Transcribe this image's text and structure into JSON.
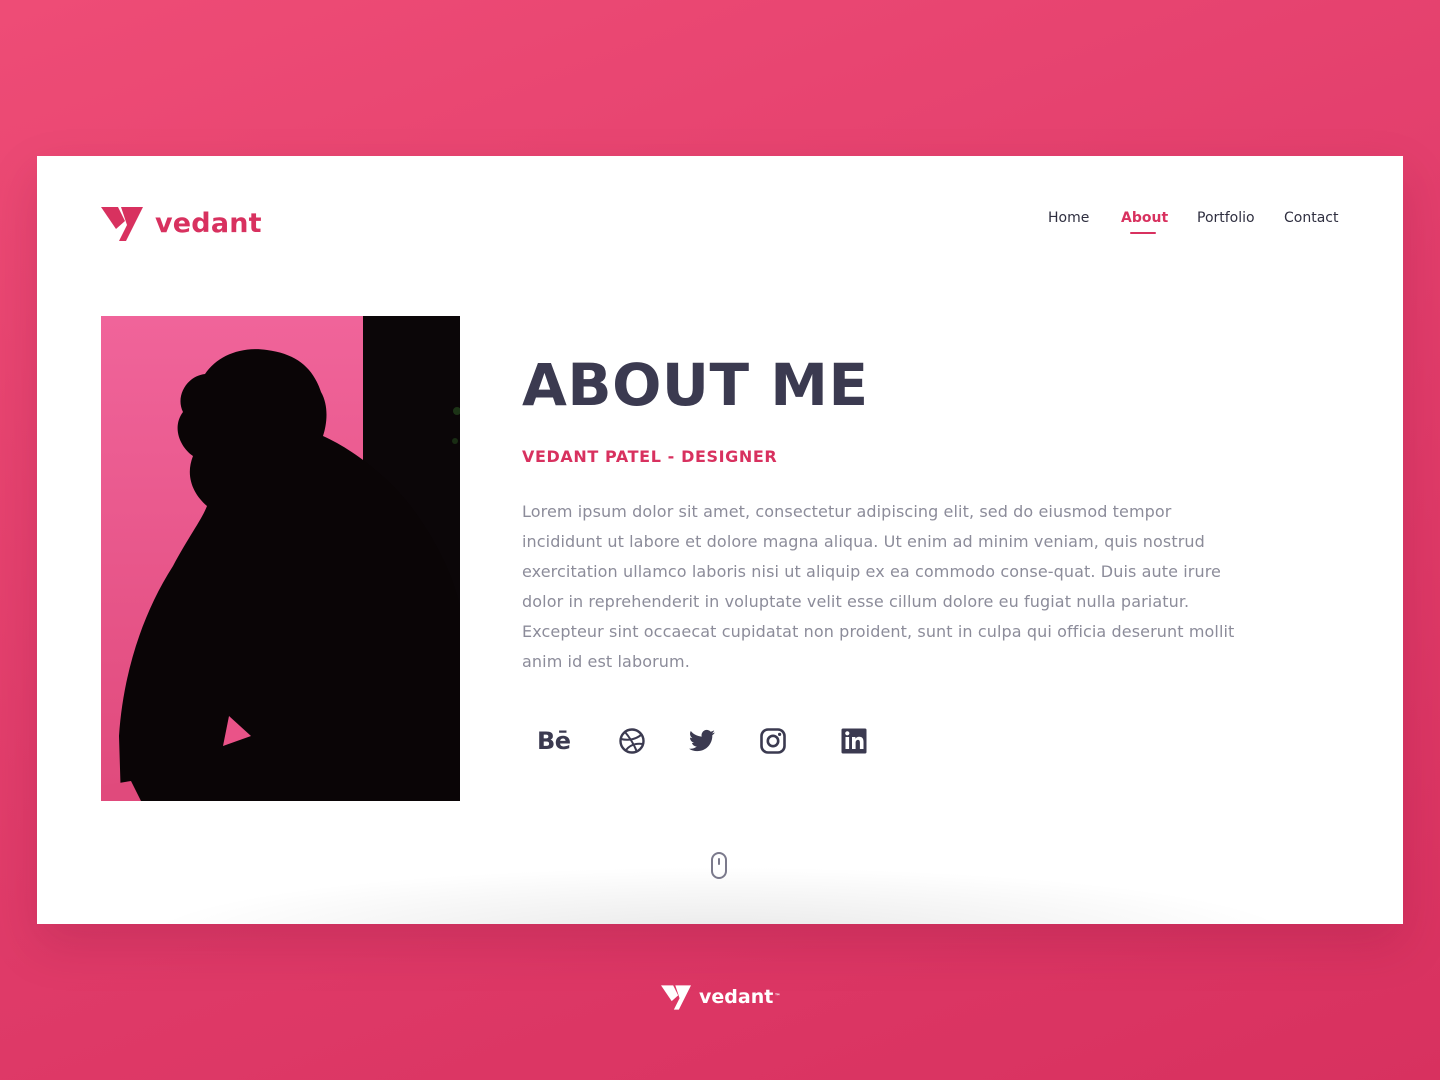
{
  "brand": {
    "name": "vedant",
    "color": "#d8315f",
    "icon": "v-logo-icon"
  },
  "nav": {
    "items": [
      {
        "label": "Home",
        "active": false
      },
      {
        "label": "About",
        "active": true
      },
      {
        "label": "Portfolio",
        "active": false
      },
      {
        "label": "Contact",
        "active": false
      }
    ]
  },
  "about": {
    "heading": "ABOUT ME",
    "subtitle": "VEDANT PATEL - DESIGNER",
    "bio": "Lorem ipsum dolor sit amet, consectetur adipiscing elit, sed do eiusmod tempor incididunt ut labore et dolore magna aliqua. Ut enim ad minim veniam, quis nostrud exercitation ullamco laboris nisi ut aliquip ex ea commodo conse-quat. Duis aute irure dolor in reprehenderit in voluptate velit esse cillum dolore eu fugiat nulla pariatur. Excepteur sint occaecat cupidatat non proident, sunt in culpa qui officia deserunt mollit anim id est laborum."
  },
  "social": [
    {
      "name": "Behance",
      "icon": "behance-icon",
      "glyph": "Bē"
    },
    {
      "name": "Dribbble",
      "icon": "dribbble-icon"
    },
    {
      "name": "Twitter",
      "icon": "twitter-icon"
    },
    {
      "name": "Instagram",
      "icon": "instagram-icon"
    },
    {
      "name": "LinkedIn",
      "icon": "linkedin-icon"
    }
  ],
  "scroll_indicator": {
    "icon": "mouse-scroll-icon"
  },
  "footer": {
    "brand": "vedant",
    "tm": "™"
  },
  "colors": {
    "background_gradient": [
      "#ee4c76",
      "#d8315f"
    ],
    "card": "#ffffff",
    "heading": "#3b3a50",
    "accent": "#d8315f",
    "body_text": "#8c8c9a"
  }
}
